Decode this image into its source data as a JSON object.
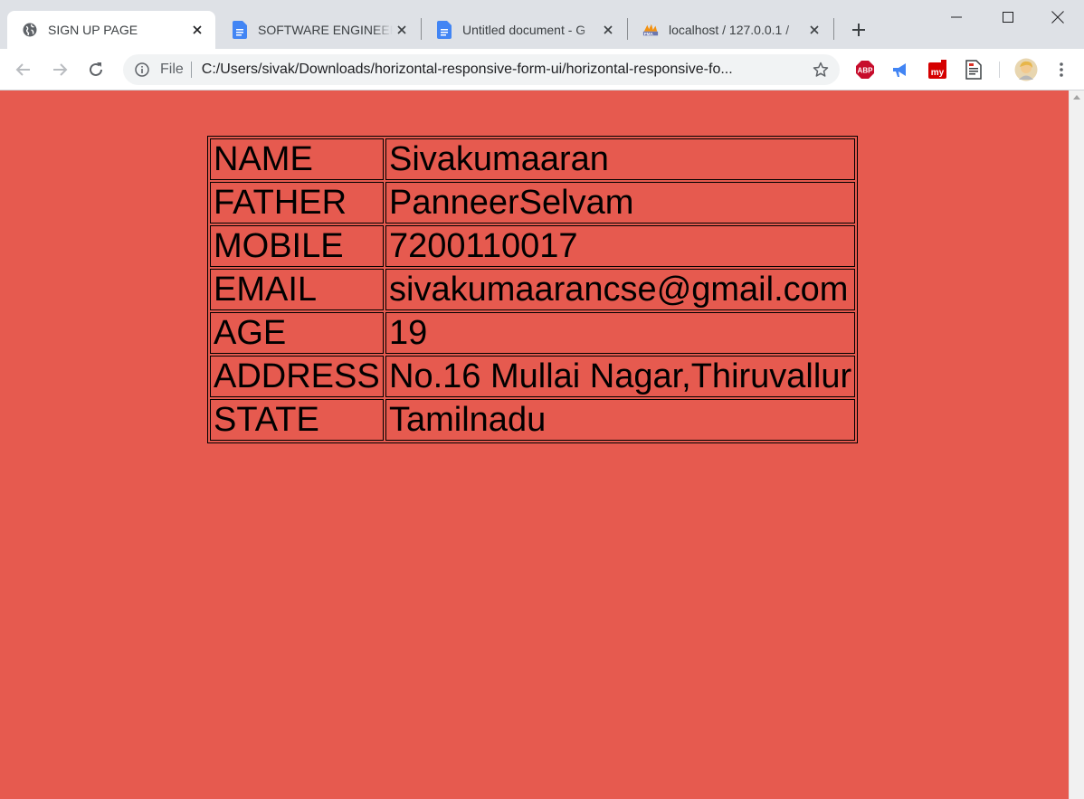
{
  "tabs": [
    {
      "title": "SIGN UP PAGE",
      "icon": "globe-icon",
      "active": true
    },
    {
      "title": "SOFTWARE ENGINEER",
      "icon": "google-docs-icon",
      "active": false
    },
    {
      "title": "Untitled document - G",
      "icon": "google-docs-icon",
      "active": false
    },
    {
      "title": "localhost / 127.0.0.1 / ",
      "icon": "phpmyadmin-icon",
      "active": false
    }
  ],
  "omnibox": {
    "scheme": "File",
    "url": "C:/Users/sivak/Downloads/horizontal-responsive-form-ui/horizontal-responsive-fo..."
  },
  "extensions": {
    "adblock": "ABP",
    "my": "my"
  },
  "colors": {
    "page_background": "#e65a4f",
    "text": "#000000",
    "tabstrip": "#dee1e6"
  },
  "table": {
    "rows": [
      {
        "label": "NAME",
        "value": "Sivakumaaran"
      },
      {
        "label": "FATHER",
        "value": "PanneerSelvam"
      },
      {
        "label": "MOBILE",
        "value": "7200110017"
      },
      {
        "label": "EMAIL",
        "value": "sivakumaarancse@gmail.com"
      },
      {
        "label": "AGE",
        "value": "19"
      },
      {
        "label": "ADDRESS",
        "value": "No.16 Mullai Nagar,Thiruvallur"
      },
      {
        "label": "STATE",
        "value": "Tamilnadu"
      }
    ]
  }
}
